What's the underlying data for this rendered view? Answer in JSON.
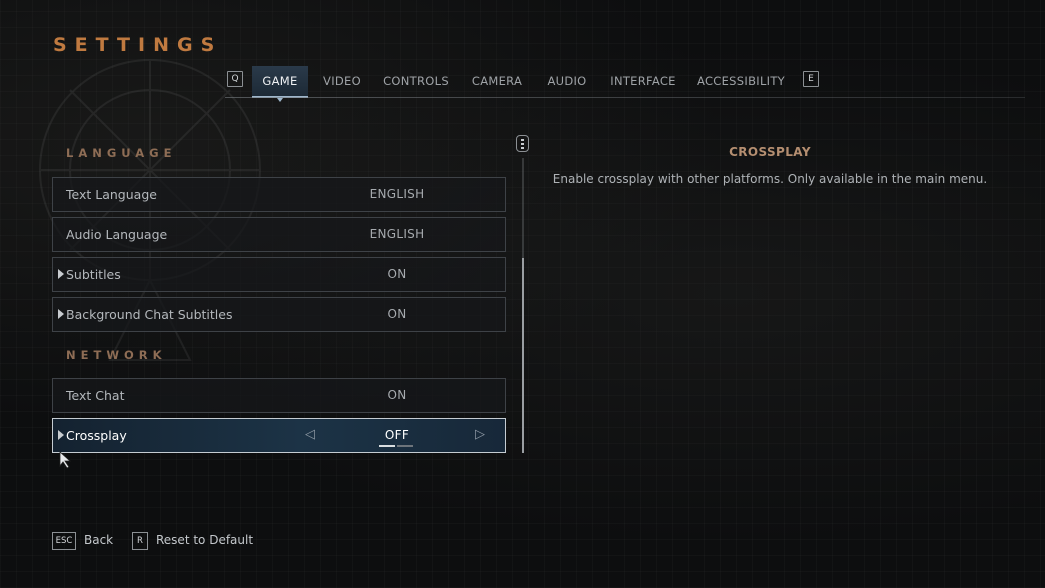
{
  "page": {
    "title": "SETTINGS"
  },
  "tabs": {
    "prev_key": "Q",
    "next_key": "E",
    "items": [
      {
        "label": "GAME",
        "active": true
      },
      {
        "label": "VIDEO",
        "active": false
      },
      {
        "label": "CONTROLS",
        "active": false
      },
      {
        "label": "CAMERA",
        "active": false
      },
      {
        "label": "AUDIO",
        "active": false
      },
      {
        "label": "INTERFACE",
        "active": false
      },
      {
        "label": "ACCESSIBILITY",
        "active": false
      }
    ]
  },
  "sections": {
    "language": {
      "heading": "LANGUAGE",
      "rows": [
        {
          "label": "Text Language",
          "value": "ENGLISH",
          "expandable": false
        },
        {
          "label": "Audio Language",
          "value": "ENGLISH",
          "expandable": false
        },
        {
          "label": "Subtitles",
          "value": "ON",
          "expandable": true
        },
        {
          "label": "Background Chat Subtitles",
          "value": "ON",
          "expandable": true
        }
      ]
    },
    "network": {
      "heading": "NETWORK",
      "rows": [
        {
          "label": "Text Chat",
          "value": "ON",
          "expandable": false
        },
        {
          "label": "Crossplay",
          "value": "OFF",
          "expandable": true,
          "selected": true,
          "option_count": 2,
          "option_index": 0
        }
      ]
    }
  },
  "detail": {
    "title": "CROSSPLAY",
    "description": "Enable crossplay with other platforms. Only available in the main menu."
  },
  "footer": {
    "back_key": "ESC",
    "back_label": "Back",
    "reset_key": "R",
    "reset_label": "Reset to Default"
  },
  "colors": {
    "title_accent": "#c07a40",
    "section_heading": "#8e6d55",
    "selected_row": "#1c3346",
    "active_tab": "#2a3a4a"
  },
  "icons": {
    "expand": "triangle-right-icon",
    "prev_option": "arrow-left-icon",
    "next_option": "arrow-right-icon",
    "scroll": "mouse-scroll-icon",
    "cursor": "mouse-cursor-icon"
  }
}
